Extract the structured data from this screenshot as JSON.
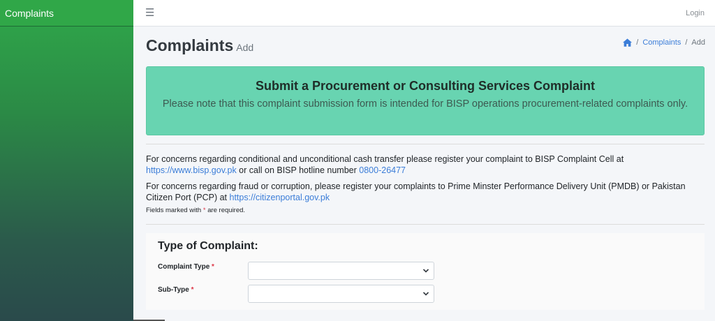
{
  "sidebar": {
    "brand": "Complaints"
  },
  "topbar": {
    "menu_icon": "bars-icon",
    "login_label": "Login"
  },
  "page": {
    "title": "Complaints",
    "subtitle": "Add"
  },
  "breadcrumb": {
    "home_icon": "home-icon",
    "items": [
      "Complaints",
      "Add"
    ],
    "separator": "/"
  },
  "banner": {
    "title": "Submit a Procurement or Consulting Services Complaint",
    "text": "Please note that this complaint submission form is intended for BISP operations procurement-related complaints only.",
    "color": "#68d4b1"
  },
  "info1": {
    "text_a": "For concerns regarding conditional and unconditional cash transfer please register your complaint to BISP Complaint Cell at",
    "link": "https://www.bisp.gov.pk",
    "text_b": "or call on BISP hotline number",
    "phone": "0800-26477"
  },
  "info2": {
    "text": "For concerns regarding fraud or corruption, please register your complaints to Prime Minster Performance Delivery Unit (PMDB) or Pakistan Citizen Port (PCP) at",
    "link": "https://citizenportal.gov.pk"
  },
  "required_note": {
    "before": "Fields marked with",
    "star": "*",
    "after": "are required."
  },
  "form": {
    "title": "Type of Complaint:",
    "complaint_type_label": "Complaint Type",
    "sub_type_label": "Sub-Type",
    "required_star": "*",
    "complaint_type_value": "",
    "sub_type_value": ""
  },
  "colors": {
    "sidebar_green": "#30a748",
    "link_blue": "#3b7dd8",
    "required_red": "#dc3545"
  }
}
